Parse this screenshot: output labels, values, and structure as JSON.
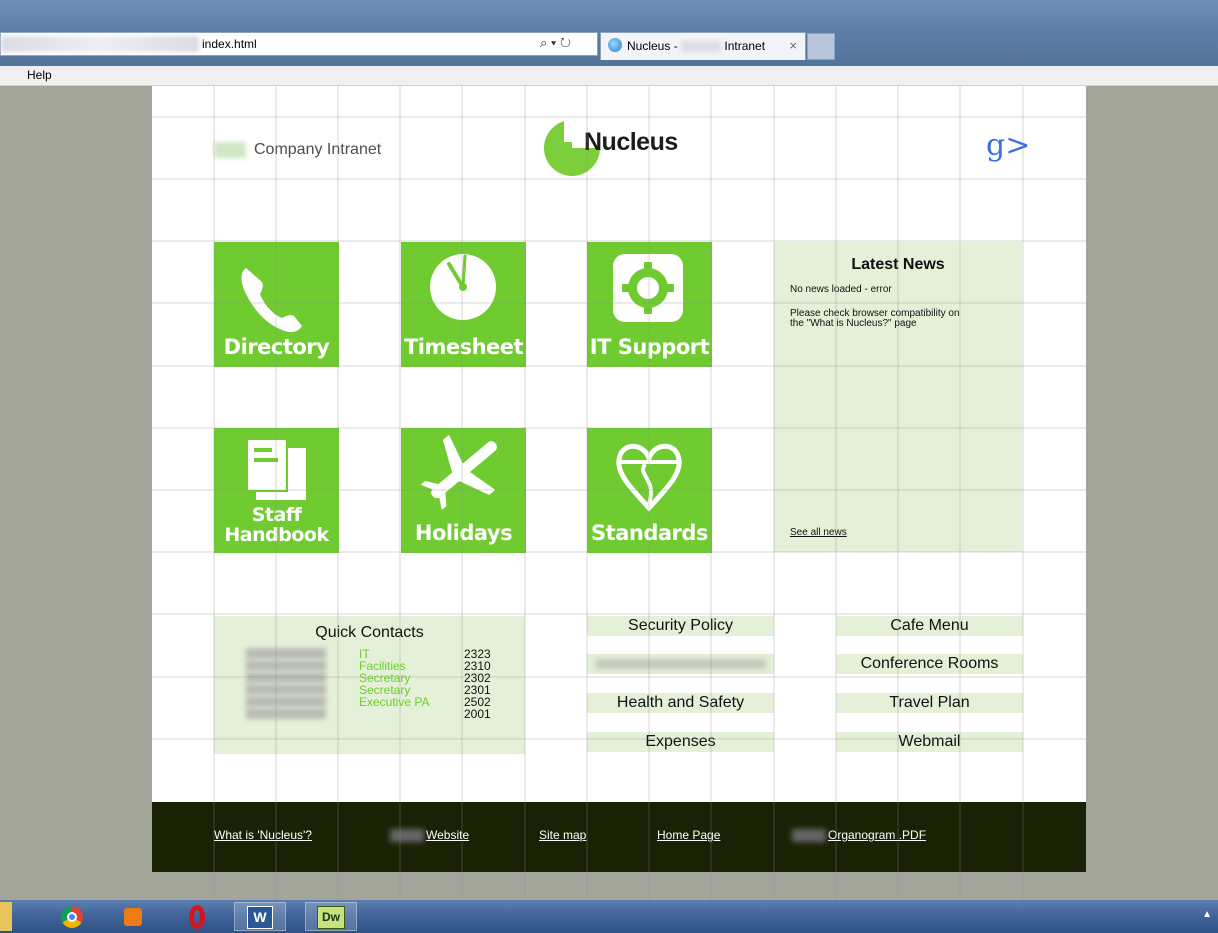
{
  "browser": {
    "address_url": "index.html",
    "tab_title_prefix": "Nucleus -",
    "tab_title_suffix": "Intranet",
    "tab_close": "×",
    "address_tools": "⌕ ▾ ↻",
    "menu_help": "Help"
  },
  "header": {
    "company_label": "Company Intranet",
    "brand_name": "Nucleus",
    "social_icon": "g>"
  },
  "tiles": [
    {
      "label": "Directory",
      "icon": "phone-icon"
    },
    {
      "label": "Timesheet",
      "icon": "clock-icon"
    },
    {
      "label": "IT Support",
      "icon": "gear-icon"
    },
    {
      "label_line1": "Staff",
      "label_line2": "Handbook",
      "icon": "document-icon"
    },
    {
      "label": "Holidays",
      "icon": "airplane-icon"
    },
    {
      "label": "Standards",
      "icon": "heart-shield-icon"
    }
  ],
  "news": {
    "title": "Latest News",
    "message": "No news loaded - error",
    "hint_line1": "Please check browser compatibility on",
    "hint_line2": "the \"What is Nucleus?\" page",
    "see_all": "See all news"
  },
  "quick_contacts": {
    "title": "Quick Contacts",
    "rows": [
      {
        "role": "IT",
        "ext": "2323"
      },
      {
        "role": "Facilities",
        "ext": "2310"
      },
      {
        "role": "Secretary",
        "ext": "2302"
      },
      {
        "role": "Secretary",
        "ext": "2301"
      },
      {
        "role": "Executive PA",
        "ext": "2502"
      },
      {
        "role": "",
        "ext": "2001"
      }
    ]
  },
  "middle_links": {
    "security_policy": "Security Policy",
    "health_safety": "Health and Safety",
    "expenses": "Expenses"
  },
  "right_links": {
    "cafe_menu": "Cafe Menu",
    "conference_rooms": "Conference Rooms",
    "travel_plan": "Travel Plan",
    "webmail": "Webmail"
  },
  "footer": {
    "what_is": "What is 'Nucleus'?",
    "website": "Website",
    "site_map": "Site map",
    "home_page": "Home Page",
    "organogram": "Organogram .PDF"
  },
  "taskbar": {
    "word_label": "W",
    "dw_label": "Dw",
    "tray_arrow": "▲"
  },
  "colors": {
    "tile_green": "#6fcb2f",
    "panel_green": "#e4f0d8",
    "footer_dark": "#1a2206",
    "side_gray": "#a3a59b"
  }
}
